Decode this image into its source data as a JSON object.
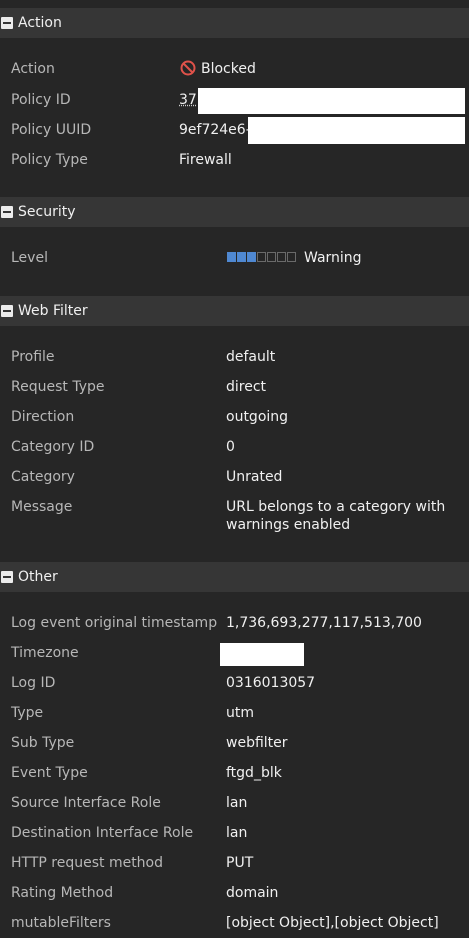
{
  "sections": {
    "action": {
      "title": "Action",
      "rows": [
        {
          "label": "Action",
          "value": "Blocked"
        },
        {
          "label": "Policy ID",
          "value": "37"
        },
        {
          "label": "Policy UUID",
          "value": "9ef724e6-"
        },
        {
          "label": "Policy Type",
          "value": "Firewall"
        }
      ]
    },
    "security": {
      "title": "Security",
      "rows": [
        {
          "label": "Level",
          "value": "Warning",
          "level_filled": 3,
          "level_total": 7
        }
      ]
    },
    "web_filter": {
      "title": "Web Filter",
      "rows": [
        {
          "label": "Profile",
          "value": "default"
        },
        {
          "label": "Request Type",
          "value": "direct"
        },
        {
          "label": "Direction",
          "value": "outgoing"
        },
        {
          "label": "Category ID",
          "value": "0"
        },
        {
          "label": "Category",
          "value": "Unrated"
        },
        {
          "label": "Message",
          "value": "URL belongs to a category with warnings enabled"
        }
      ]
    },
    "other": {
      "title": "Other",
      "rows": [
        {
          "label": "Log event original timestamp",
          "value": "1,736,693,277,117,513,700"
        },
        {
          "label": "Timezone",
          "value": ""
        },
        {
          "label": "Log ID",
          "value": "0316013057"
        },
        {
          "label": "Type",
          "value": "utm"
        },
        {
          "label": "Sub Type",
          "value": "webfilter"
        },
        {
          "label": "Event Type",
          "value": "ftgd_blk"
        },
        {
          "label": "Source Interface Role",
          "value": "lan"
        },
        {
          "label": "Destination Interface Role",
          "value": "lan"
        },
        {
          "label": "HTTP request method",
          "value": "PUT"
        },
        {
          "label": "Rating Method",
          "value": "domain"
        },
        {
          "label": "mutableFilters",
          "value": "[object Object],[object Object]"
        }
      ]
    }
  },
  "colors": {
    "background": "#262626",
    "header": "#363636",
    "label": "#b7b7b7",
    "value": "#f0f0f0",
    "blocked": "#e0524a",
    "level_on": "#4f88d1"
  },
  "icons": {
    "blocked": "blocked-icon",
    "collapse": "collapse-toggle-icon"
  }
}
